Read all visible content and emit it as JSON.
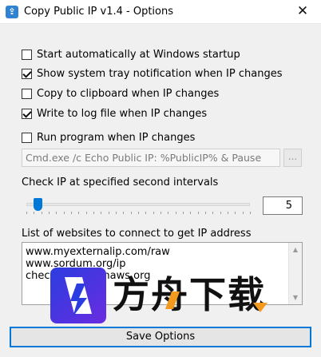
{
  "window": {
    "title": "Copy Public IP v1.4 - Options",
    "close_glyph": "✕",
    "icon": "app-icon"
  },
  "options": [
    {
      "label": "Start automatically at Windows startup",
      "checked": false
    },
    {
      "label": "Show system tray notification when IP changes",
      "checked": true
    },
    {
      "label": "Copy to clipboard when IP changes",
      "checked": false
    },
    {
      "label": "Write to log file when IP changes",
      "checked": true
    },
    {
      "label": "Run program when IP changes",
      "checked": false
    }
  ],
  "run_program": {
    "command": "Cmd.exe /c Echo Public IP: %PublicIP% & Pause",
    "browse_label": "..."
  },
  "interval": {
    "label": "Check IP at specified second intervals",
    "value": "5",
    "slider_fraction": 0.05
  },
  "websites": {
    "label": "List of websites to connect to get IP address",
    "items": [
      "www.myexternalip.com/raw",
      "www.sordum.org/ip",
      "checkip.amazonaws.org"
    ]
  },
  "watermark": {
    "text": "方舟下载"
  },
  "save_label": "Save Options",
  "colors": {
    "accent": "#0078d7",
    "watermark_orange": "#f39a1e",
    "watermark_blue": "#2b3de0"
  }
}
